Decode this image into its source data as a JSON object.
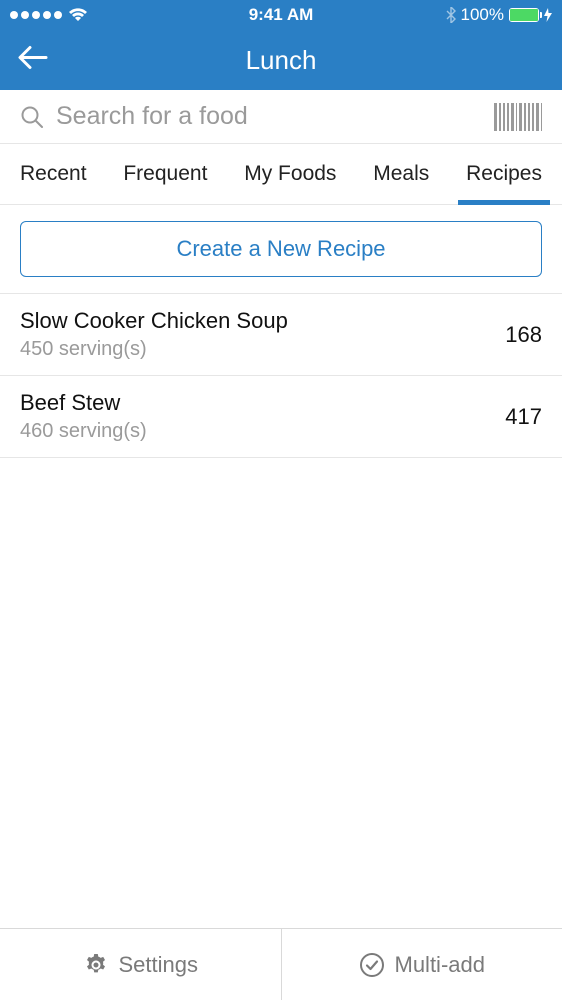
{
  "status": {
    "time": "9:41 AM",
    "battery_pct": "100%"
  },
  "nav": {
    "title": "Lunch"
  },
  "search": {
    "placeholder": "Search for a food"
  },
  "tabs": [
    {
      "label": "Recent",
      "active": false
    },
    {
      "label": "Frequent",
      "active": false
    },
    {
      "label": "My Foods",
      "active": false
    },
    {
      "label": "Meals",
      "active": false
    },
    {
      "label": "Recipes",
      "active": true
    }
  ],
  "create_button": "Create a New Recipe",
  "recipes": [
    {
      "name": "Slow Cooker Chicken Soup",
      "servings": "450 serving(s)",
      "calories": "168"
    },
    {
      "name": "Beef Stew",
      "servings": "460 serving(s)",
      "calories": "417"
    }
  ],
  "footer": {
    "settings": "Settings",
    "multi_add": "Multi-add"
  },
  "colors": {
    "primary": "#2a7fc5"
  }
}
